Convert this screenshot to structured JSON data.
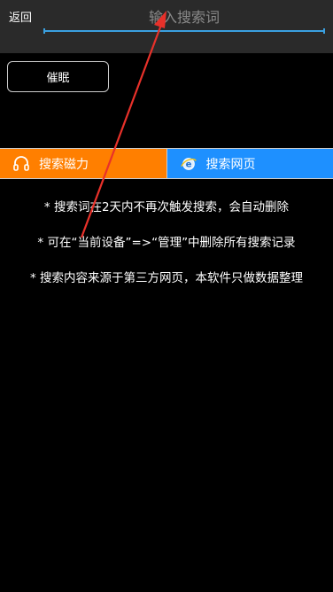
{
  "header": {
    "back_label": "返回",
    "search_placeholder": "输入搜索词",
    "accent_color": "#3aa0e0"
  },
  "hypnosis_button": {
    "label": "催眠"
  },
  "tabs": [
    {
      "label": "搜索磁力",
      "icon": "headphones-icon",
      "color": "#ff7f00"
    },
    {
      "label": "搜索网页",
      "icon": "internet-explorer-icon",
      "color": "#1e90ff"
    }
  ],
  "notes": [
    "* 搜索词在2天内不再次触发搜索，会自动删除",
    "* 可在“当前设备”=>“管理”中删除所有搜索记录",
    "* 搜索内容来源于第三方网页，本软件只做数据整理"
  ],
  "annotation": {
    "type": "red-arrow",
    "color": "#e8312a",
    "points_to": "search-input"
  }
}
